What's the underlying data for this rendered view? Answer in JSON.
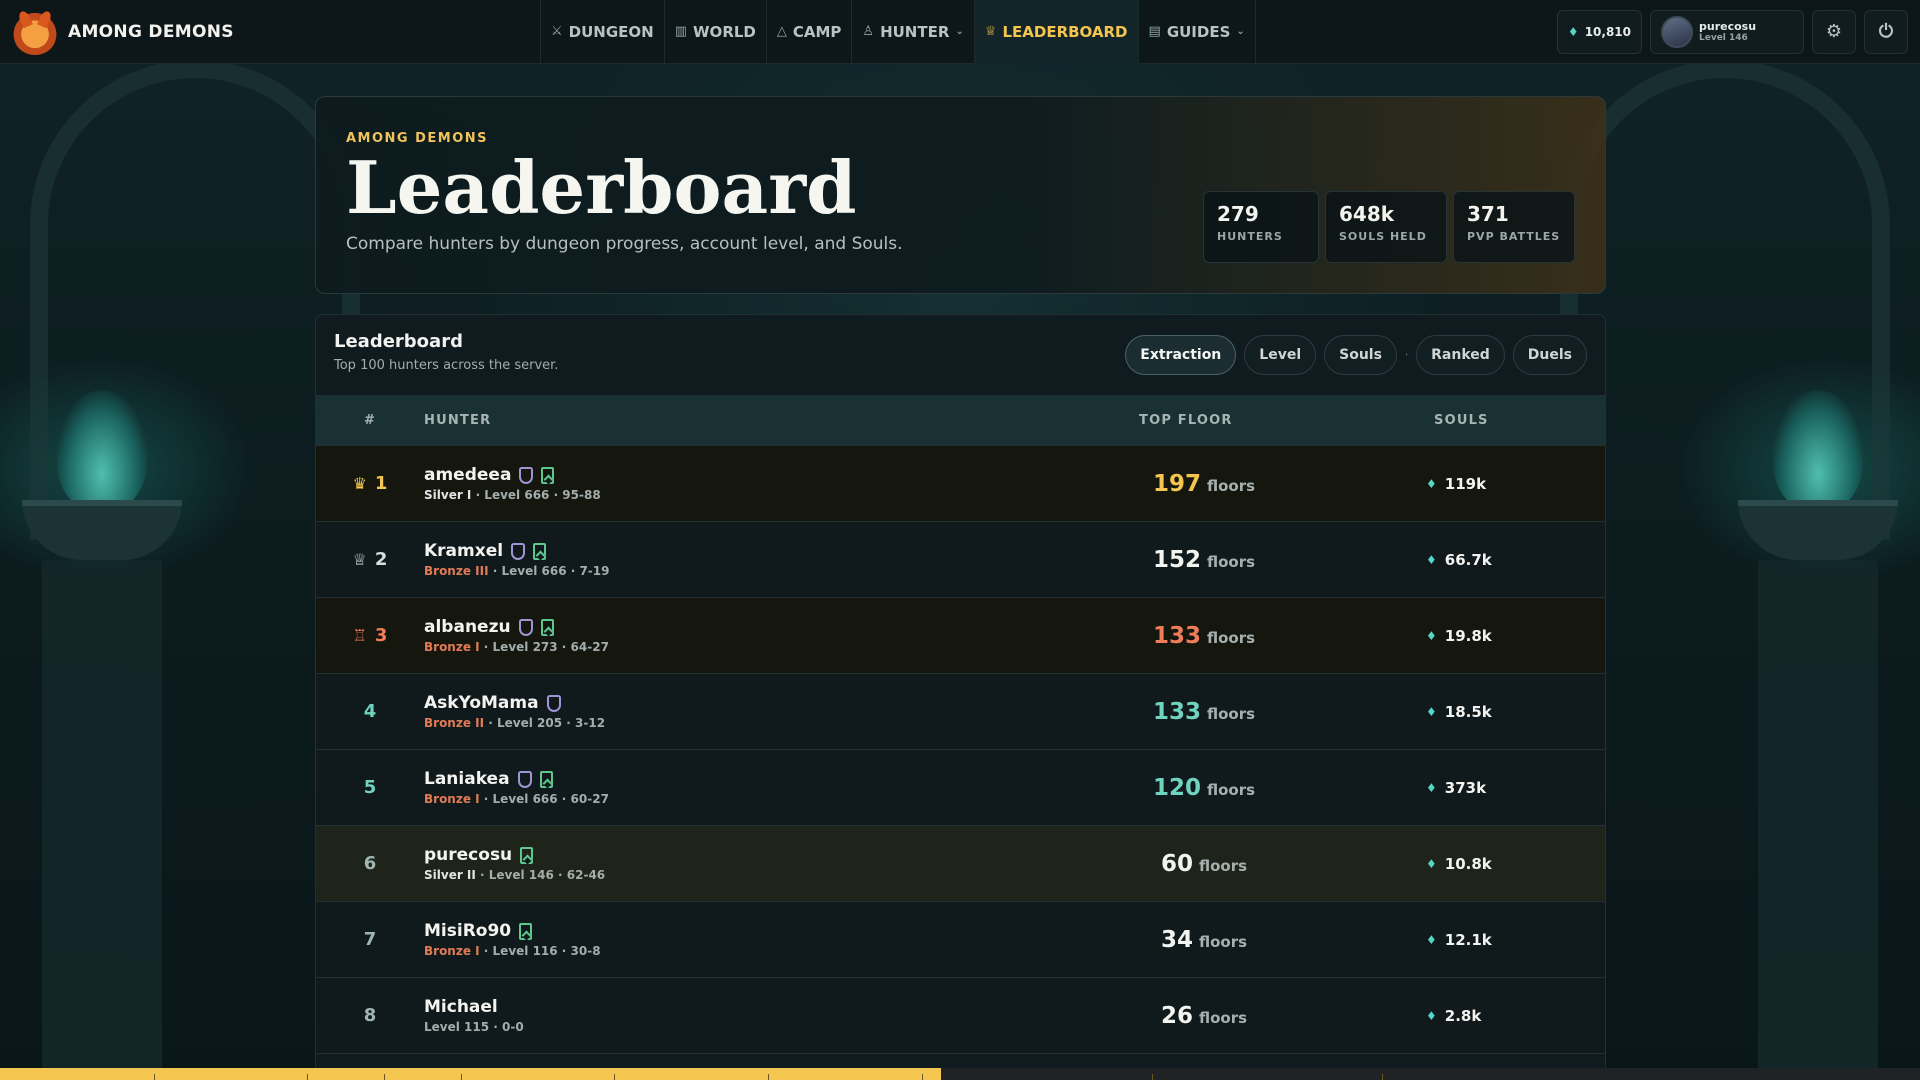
{
  "brand": {
    "name": "AMONG DEMONS"
  },
  "nav": [
    {
      "label": "DUNGEON",
      "icon": "swords-icon",
      "glyph": "⚔"
    },
    {
      "label": "WORLD",
      "icon": "map-icon",
      "glyph": "▥"
    },
    {
      "label": "CAMP",
      "icon": "tent-icon",
      "glyph": "△"
    },
    {
      "label": "HUNTER",
      "icon": "user-icon",
      "glyph": "♙",
      "chevron": "⌄"
    },
    {
      "label": "LEADERBOARD",
      "icon": "trophy-icon",
      "glyph": "🏆",
      "active": true
    },
    {
      "label": "GUIDES",
      "icon": "book-icon",
      "glyph": "▤",
      "chevron": "⌄"
    }
  ],
  "top_right": {
    "souls_balance": "10,810",
    "user_name": "purecosu",
    "user_level": "Level 146",
    "settings_icon": "gear-icon",
    "power_icon": "power-icon"
  },
  "hero": {
    "eyebrow": "AMONG DEMONS",
    "title": "Leaderboard",
    "subtitle": "Compare hunters by dungeon progress, account level, and Souls.",
    "stats": [
      {
        "value": "279",
        "label": "HUNTERS"
      },
      {
        "value": "648k",
        "label": "SOULS HELD"
      },
      {
        "value": "371",
        "label": "PVP BATTLES"
      }
    ]
  },
  "board": {
    "title": "Leaderboard",
    "subtitle": "Top 100 hunters across the server.",
    "tabs": [
      "Extraction",
      "Level",
      "Souls",
      "Ranked",
      "Duels"
    ],
    "active_tab": "Extraction",
    "tab_separator": "·",
    "columns": {
      "rank": "#",
      "hunter": "HUNTER",
      "floor": "TOP FLOOR",
      "souls": "SOULS"
    },
    "floor_unit": "floors",
    "rows": [
      {
        "rank": "1",
        "name": "amedeea",
        "tier": "Silver I",
        "meta": " · Level 666 · 95-88",
        "floor": "197",
        "souls": "119k"
      },
      {
        "rank": "2",
        "name": "Kramxel",
        "tier": "Bronze III",
        "meta": " · Level 666 · 7-19",
        "floor": "152",
        "souls": "66.7k"
      },
      {
        "rank": "3",
        "name": "albanezu",
        "tier": "Bronze I",
        "meta": " · Level 273 · 64-27",
        "floor": "133",
        "souls": "19.8k"
      },
      {
        "rank": "4",
        "name": "AskYoMama",
        "tier": "Bronze II",
        "meta": " · Level 205 · 3-12",
        "floor": "133",
        "souls": "18.5k"
      },
      {
        "rank": "5",
        "name": "Laniakea",
        "tier": "Bronze I",
        "meta": " · Level 666 · 60-27",
        "floor": "120",
        "souls": "373k"
      },
      {
        "rank": "6",
        "name": "purecosu",
        "tier": "Silver II",
        "meta": " · Level 146 · 62-46",
        "floor": "60",
        "souls": "10.8k"
      },
      {
        "rank": "7",
        "name": "MisiRo90",
        "tier": "Bronze I",
        "meta": " · Level 116 · 30-8",
        "floor": "34",
        "souls": "12.1k"
      },
      {
        "rank": "8",
        "name": "Michael",
        "tier": "",
        "meta": "Level 115 · 0-0",
        "floor": "26",
        "souls": "2.8k"
      }
    ]
  },
  "colors": {
    "accent_gold": "#f4c64f",
    "bronze": "#ef7d5a",
    "teal": "#6fd3c0",
    "soul": "#56d6c7"
  },
  "progress_strip": {
    "fill_fraction": 0.49
  }
}
